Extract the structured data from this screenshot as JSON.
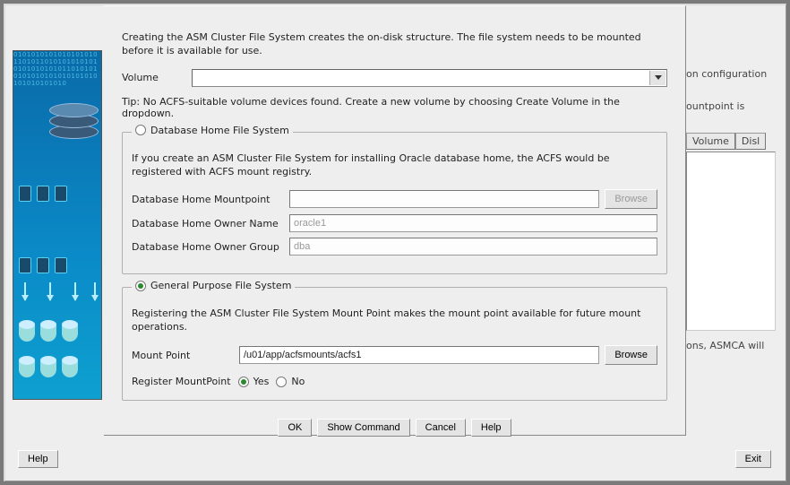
{
  "background": {
    "right_text1": "on configuration",
    "right_text2": "ountpoint is",
    "right_text3": "ons, ASMCA will",
    "th_volume": "Volume",
    "th_disk": "Disl"
  },
  "outer": {
    "help": "Help",
    "exit": "Exit"
  },
  "dialog": {
    "intro": "Creating the ASM Cluster File System creates the on-disk structure. The file system needs to be mounted before it is available for use.",
    "volume_label": "Volume",
    "volume_value": "",
    "tip": "Tip: No ACFS-suitable volume devices found. Create a new volume by choosing Create Volume in the dropdown.",
    "group_db": {
      "legend": "Database Home File System",
      "desc": "If you create an ASM Cluster File System for installing Oracle database home, the ACFS would be registered with ACFS mount registry.",
      "mountpoint_label": "Database Home Mountpoint",
      "mountpoint_value": "",
      "browse": "Browse",
      "owner_name_label": "Database Home Owner Name",
      "owner_name_value": "oracle1",
      "owner_group_label": "Database Home Owner Group",
      "owner_group_value": "dba"
    },
    "group_gp": {
      "legend": "General Purpose File System",
      "desc": "Registering the ASM Cluster File System Mount Point makes the mount point available for future mount operations.",
      "mountpoint_label": "Mount Point",
      "mountpoint_value": "/u01/app/acfsmounts/acfs1",
      "browse": "Browse",
      "register_label": "Register MountPoint",
      "yes": "Yes",
      "no": "No",
      "register_selected": "yes"
    },
    "buttons": {
      "ok": "OK",
      "show_command": "Show Command",
      "cancel": "Cancel",
      "help": "Help"
    }
  }
}
